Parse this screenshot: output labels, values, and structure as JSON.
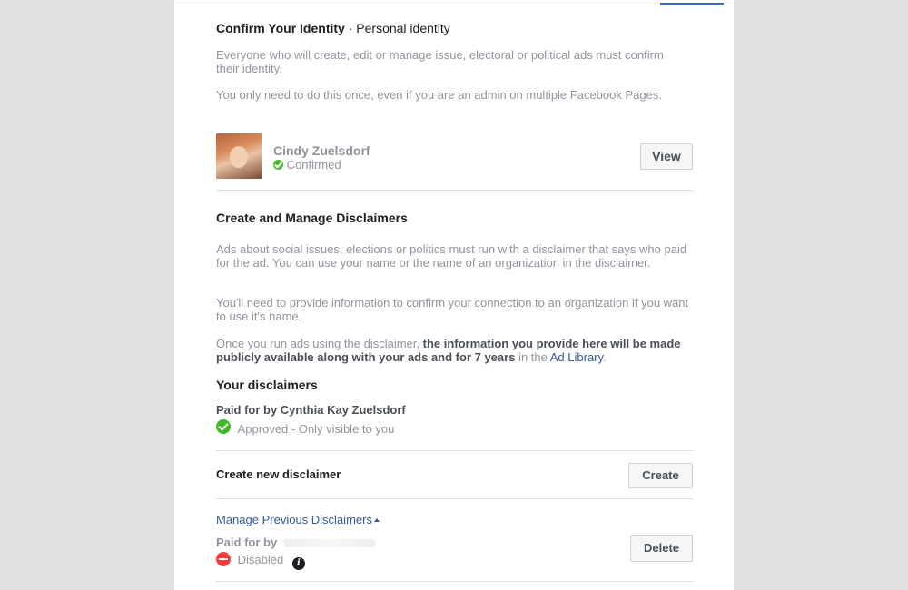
{
  "identity": {
    "title": "Confirm Your Identity",
    "separator": " · ",
    "subtitle": "Personal identity",
    "para1": "Everyone who will create, edit or manage issue, electoral or political ads must confirm their identity.",
    "para2": "You only need to do this once, even if you are an admin on multiple Facebook Pages.",
    "user_name": "Cindy Zuelsdorf",
    "status": "Confirmed",
    "view_label": "View"
  },
  "disclaimers": {
    "title": "Create and Manage Disclaimers",
    "para1": "Ads about social issues, elections or politics must run with a disclaimer that says who paid for the ad. You can use your name or the name of an organization in the disclaimer.",
    "para2": "You'll need to provide information to confirm your connection to an organization if you want to use it's name.",
    "para3_start": "Once you run ads using the disclaimer, ",
    "para3_bold": "the information you provide here will be made publicly available along with your ads and for 7 years",
    "para3_mid": " in the ",
    "para3_link": "Ad Library",
    "para3_end": ".",
    "your_title": "Your disclaimers",
    "current_name": "Paid for by Cynthia Kay Zuelsdorf",
    "current_status": "Approved - Only visible to you",
    "create_title": "Create new disclaimer",
    "create_label": "Create",
    "manage_link": "Manage Previous Disclaimers",
    "previous_name": "Paid for by",
    "previous_status": "Disabled",
    "delete_label": "Delete"
  },
  "colors": {
    "link": "#365899",
    "approved": "#42b72a",
    "disabled": "#fa3e3e",
    "tab_accent": "#4267b2"
  }
}
